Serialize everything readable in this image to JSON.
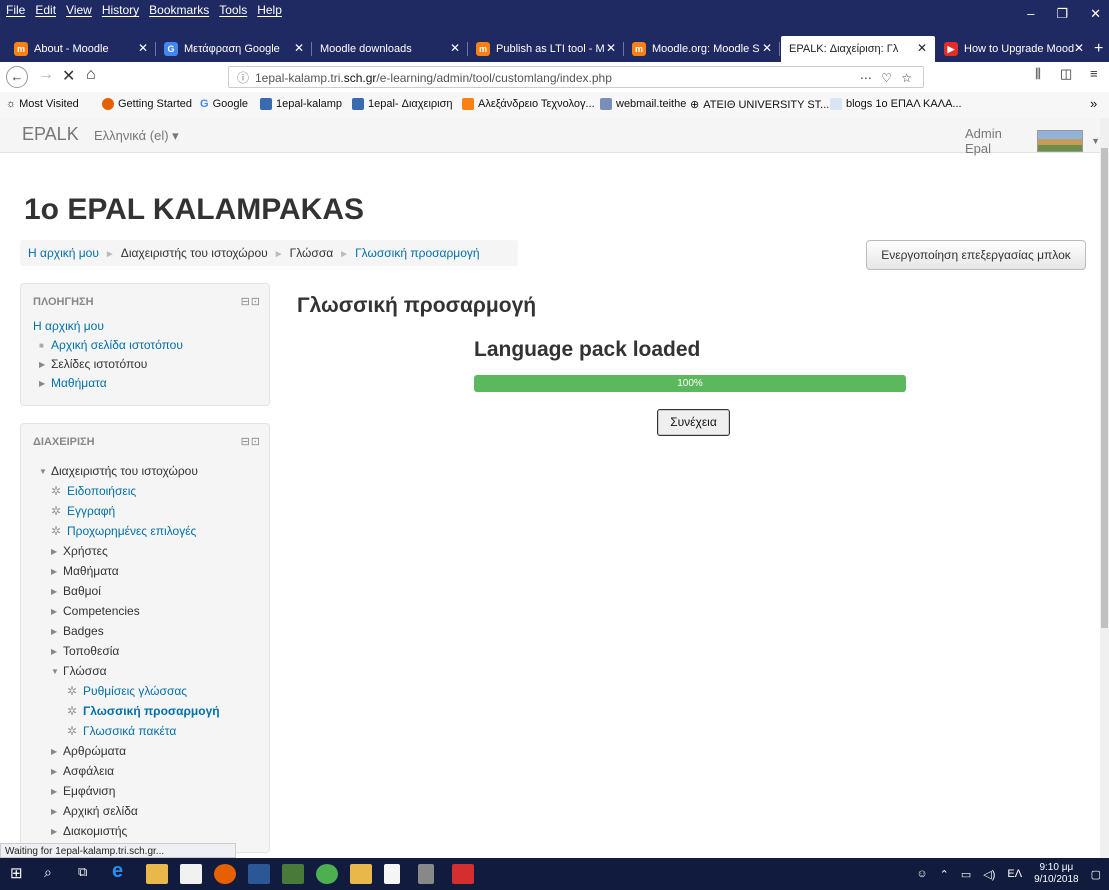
{
  "menubar": {
    "items": [
      "File",
      "Edit",
      "View",
      "History",
      "Bookmarks",
      "Tools",
      "Help"
    ]
  },
  "tabs": [
    {
      "label": "About - Moodle",
      "color": "#f98012",
      "letter": "m"
    },
    {
      "label": "Μετάφραση Google",
      "color": "#4285f4",
      "letter": "G"
    },
    {
      "label": "Moodle downloads",
      "color": "#f98012",
      "letter": "m"
    },
    {
      "label": "Publish as LTI tool - M",
      "color": "#f98012",
      "letter": "m"
    },
    {
      "label": "Moodle.org: Moodle S",
      "color": "#f98012",
      "letter": "m"
    },
    {
      "label": "EPALK: Διαχείριση: Γλ",
      "color": "#f98012",
      "letter": "•"
    },
    {
      "label": "How to Upgrade Mood",
      "color": "#e52d27",
      "letter": "▶"
    }
  ],
  "url": {
    "pre": "1epal-kalamp.tri.",
    "domain": "sch.gr",
    "post": "/e-learning/admin/tool/customlang/index.php"
  },
  "bookmarks": [
    "Most Visited",
    "Getting Started",
    "Google",
    "1epal-kalamp",
    "1epal- Διαχειριση",
    "Αλεξάνδρειο Τεχνολογ...",
    "webmail.teithe",
    "ATEIΘ UNIVERSITY ST...",
    "blogs 1ο ΕΠΑΛ ΚΑΛΑ..."
  ],
  "header": {
    "brand": "EPALK",
    "language": "Ελληνικά (el) ▾",
    "user": "Admin Epal"
  },
  "site_title": "1o EPAL KALAMPAKAS",
  "breadcrumb": {
    "home": "Η αρχική μου",
    "admin": "Διαχειριστής του ιστοχώρου",
    "lang": "Γλώσσα",
    "current": "Γλωσσική προσαρμογή"
  },
  "edit_button": "Ενεργοποίηση επεξεργασίας μπλοκ",
  "nav_block": {
    "title": "ΠΛΟΗΓΗΣΗ",
    "home": "Η αρχική μου",
    "site_home": "Αρχική σελίδα ιστοτόπου",
    "site_pages": "Σελίδες ιστοτόπου",
    "courses": "Μαθήματα"
  },
  "admin_block": {
    "title": "ΔΙΑΧΕΙΡΙΣΗ",
    "root": "Διαχειριστής του ιστοχώρου",
    "notifications": "Ειδοποιήσεις",
    "registration": "Εγγραφή",
    "advanced": "Προχωρημένες επιλογές",
    "users": "Χρήστες",
    "courses": "Μαθήματα",
    "grades": "Βαθμοί",
    "competencies": "Competencies",
    "badges": "Badges",
    "location": "Τοποθεσία",
    "language": "Γλώσσα",
    "lang_settings": "Ρυθμίσεις γλώσσας",
    "lang_custom": "Γλωσσική προσαρμογή",
    "lang_packs": "Γλωσσικά πακέτα",
    "plugins": "Αρθρώματα",
    "security": "Ασφάλεια",
    "appearance": "Εμφάνιση",
    "frontpage": "Αρχική σελίδα",
    "server": "Διακομιστής"
  },
  "main": {
    "heading": "Γλωσσική προσαρμογή",
    "pack_heading": "Language pack loaded",
    "progress_percent": 100,
    "progress_label": "100%",
    "continue": "Συνέχεια"
  },
  "status_text": "Waiting for 1epal-kalamp.tri.sch.gr...",
  "tray": {
    "lang": "ΕΛ",
    "time": "9:10 μμ",
    "date": "9/10/2018"
  }
}
